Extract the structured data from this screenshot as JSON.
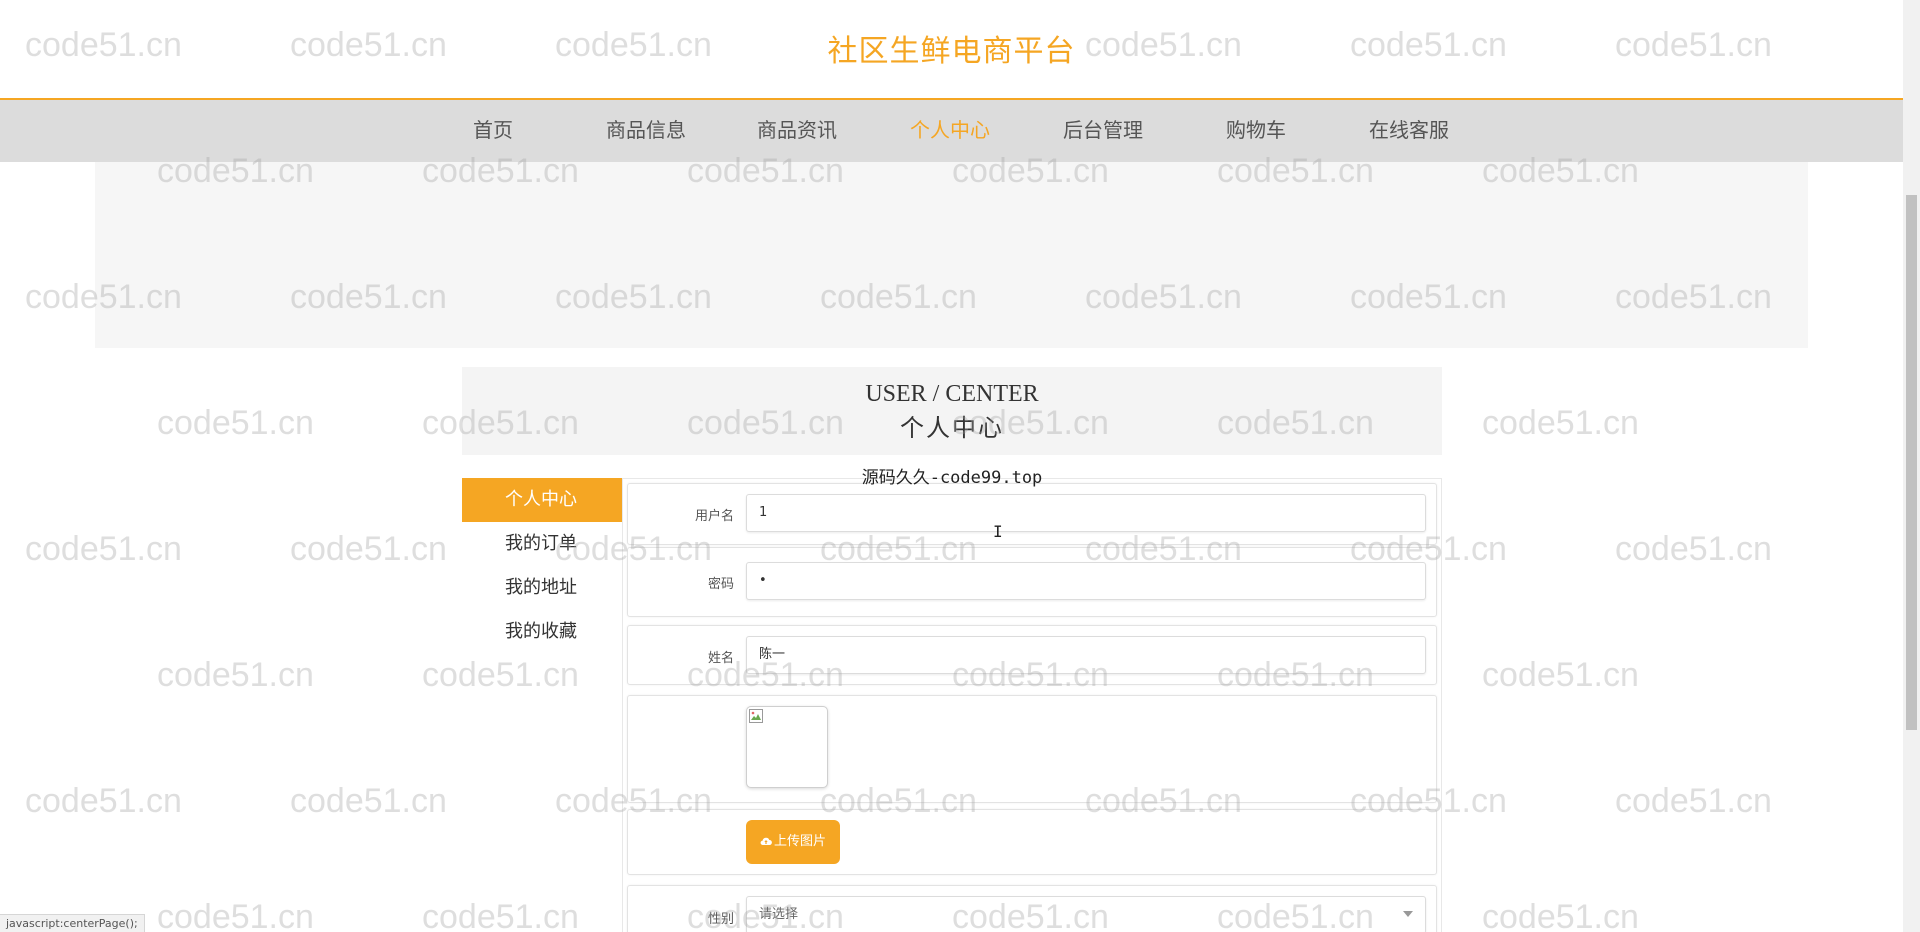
{
  "site": {
    "title": "社区生鲜电商平台"
  },
  "nav": {
    "items": [
      {
        "label": "首页"
      },
      {
        "label": "商品信息"
      },
      {
        "label": "商品资讯"
      },
      {
        "label": "个人中心",
        "active": true
      },
      {
        "label": "后台管理"
      },
      {
        "label": "购物车"
      },
      {
        "label": "在线客服"
      }
    ]
  },
  "user_center": {
    "title_en": "USER / CENTER",
    "title_cn": "个人中心",
    "source_note": "源码久久-code99.top"
  },
  "side_menu": {
    "items": [
      {
        "label": "个人中心",
        "active": true
      },
      {
        "label": "我的订单"
      },
      {
        "label": "我的地址"
      },
      {
        "label": "我的收藏"
      }
    ]
  },
  "form": {
    "username": {
      "label": "用户名",
      "value": "1"
    },
    "password": {
      "label": "密码",
      "value": "•"
    },
    "name": {
      "label": "姓名",
      "value": "陈一"
    },
    "upload": {
      "label": "上传图片",
      "icon": "cloud-upload-icon"
    },
    "gender": {
      "label": "性别",
      "placeholder": "请选择"
    }
  },
  "watermark": {
    "text": "code51.cn"
  },
  "status_bar": {
    "text": "javascript:centerPage();"
  },
  "colors": {
    "accent": "#f5a623",
    "nav_bg": "#dcdcdc",
    "banner_bg": "#f6f6f6"
  }
}
